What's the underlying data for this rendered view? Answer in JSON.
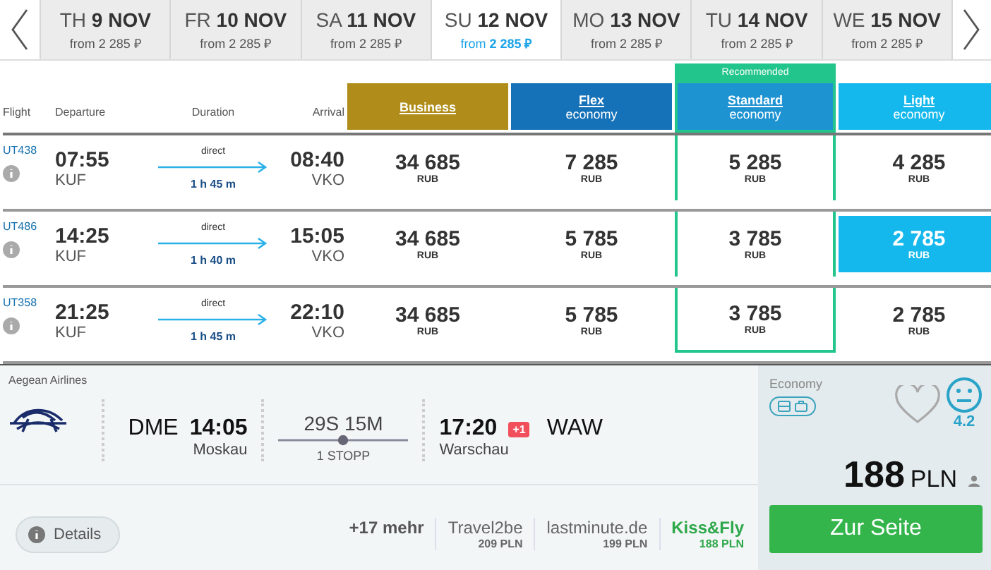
{
  "dates": [
    {
      "label": "TH **9 NOV**",
      "price": "from 2 285 ₽",
      "selected": false
    },
    {
      "label": "FR **10 NOV**",
      "price": "from 2 285 ₽",
      "selected": false
    },
    {
      "label": "SA **11 NOV**",
      "price": "from 2 285 ₽",
      "selected": false
    },
    {
      "label": "SU **12 NOV**",
      "price": "from **2 285 ₽**",
      "selected": true
    },
    {
      "label": "MO **13 NOV**",
      "price": "from 2 285 ₽",
      "selected": false
    },
    {
      "label": "TU **14 NOV**",
      "price": "from 2 285 ₽",
      "selected": false
    },
    {
      "label": "WE **15 NOV**",
      "price": "from 2 285 ₽",
      "selected": false
    }
  ],
  "columns": [
    "Flight",
    "Departure",
    "Duration",
    "Arrival"
  ],
  "fare_classes": [
    {
      "name": "Business",
      "color": "#b08d1a"
    },
    {
      "name": "Flex",
      "subtitle": "economy",
      "color": "#1571b8"
    },
    {
      "name": "Standard",
      "subtitle": "economy",
      "color": "#1e93d2",
      "badge": "Recommended"
    },
    {
      "name": "Light",
      "subtitle": "economy",
      "color": "#14b8ec"
    }
  ],
  "flights": [
    {
      "number": "UT438",
      "departure": "07:55",
      "from": "KUF",
      "stop_label": "direct",
      "duration": "1 h 45 m",
      "arrival": "08:40",
      "to": "VKO",
      "prices": [
        {
          "amount": "34 685",
          "currency": "RUB",
          "selected": false
        },
        {
          "amount": "7 285",
          "currency": "RUB",
          "selected": false
        },
        {
          "amount": "5 285",
          "currency": "RUB",
          "selected": false
        },
        {
          "amount": "4 285",
          "currency": "RUB",
          "selected": false
        }
      ]
    },
    {
      "number": "UT486",
      "departure": "14:25",
      "from": "KUF",
      "stop_label": "direct",
      "duration": "1 h 40 m",
      "arrival": "15:05",
      "to": "VKO",
      "prices": [
        {
          "amount": "34 685",
          "currency": "RUB",
          "selected": false
        },
        {
          "amount": "5 785",
          "currency": "RUB",
          "selected": false
        },
        {
          "amount": "3 785",
          "currency": "RUB",
          "selected": false
        },
        {
          "amount": "2 785",
          "currency": "RUB",
          "selected": true
        }
      ]
    },
    {
      "number": "UT358",
      "departure": "21:25",
      "from": "KUF",
      "stop_label": "direct",
      "duration": "1 h 45 m",
      "arrival": "22:10",
      "to": "VKO",
      "prices": [
        {
          "amount": "34 685",
          "currency": "RUB",
          "selected": false
        },
        {
          "amount": "5 785",
          "currency": "RUB",
          "selected": false
        },
        {
          "amount": "3 785",
          "currency": "RUB",
          "selected": false
        },
        {
          "amount": "2 785",
          "currency": "RUB",
          "selected": false
        }
      ]
    }
  ],
  "offer": {
    "airline": "Aegean Airlines",
    "from_code": "DME",
    "departure": "14:05",
    "from_city": "Moskau",
    "duration": "29S 15M",
    "stops": "1 STOPP",
    "arrival": "17:20",
    "day_offset": "+1",
    "to_code": "WAW",
    "to_city": "Warschau",
    "cabin": "Economy",
    "rating": "4.2",
    "price": "188",
    "currency": "PLN",
    "more": "+17 mehr",
    "providers": [
      {
        "name": "Travel2be",
        "price": "209 PLN",
        "best": false
      },
      {
        "name": "lastminute.de",
        "price": "199 PLN",
        "best": false
      },
      {
        "name": "Kiss&Fly",
        "price": "188 PLN",
        "best": true
      }
    ],
    "details": "Details",
    "cta": "Zur Seite"
  }
}
